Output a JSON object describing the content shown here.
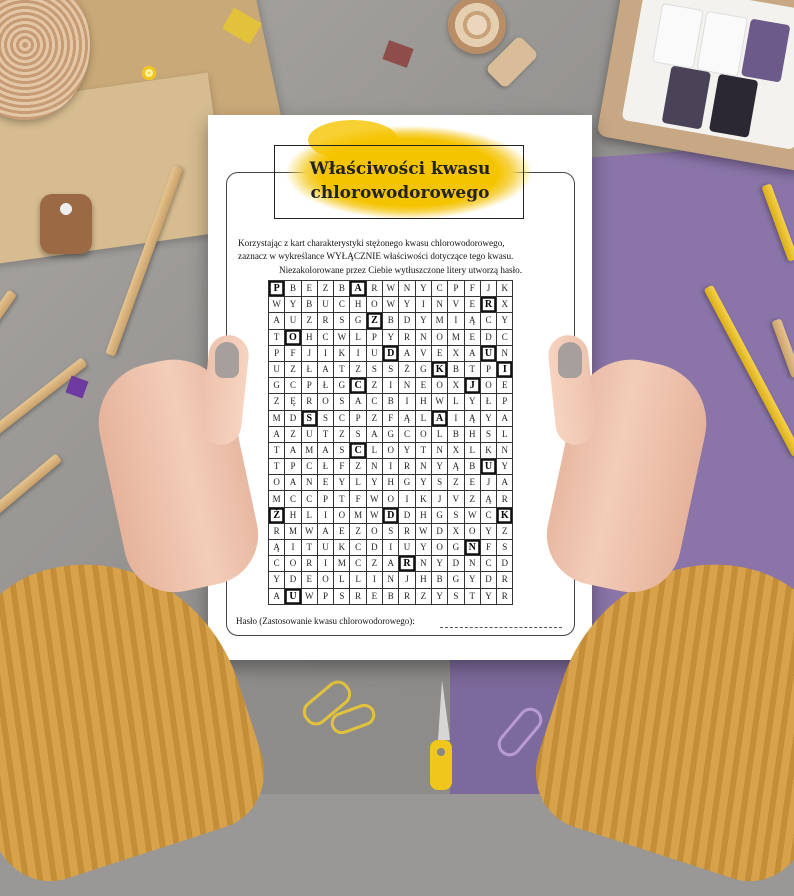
{
  "worksheet": {
    "title_line1": "Właściwości kwasu",
    "title_line2": "chlorowodorowego",
    "intro_line1": "Korzystając z kart charakterystyki stężonego kwasu chlorowodorowego,",
    "intro_line2": "zaznacz w wykreślance WYŁĄCZNIE właściwości dotyczące tego kwasu.",
    "hint": "Niezakolorowane przez Ciebie wytłuszczone litery utworzą hasło.",
    "answer_label": "Hasło (Zastosowanie kwasu chlorowodorowego):"
  },
  "grid": {
    "rows": [
      [
        "P",
        "B",
        "E",
        "Z",
        "B",
        "A",
        "R",
        "W",
        "N",
        "Y",
        "C",
        "P",
        "F",
        "J",
        "K"
      ],
      [
        "W",
        "Y",
        "B",
        "U",
        "C",
        "H",
        "O",
        "W",
        "Y",
        "I",
        "N",
        "V",
        "E",
        "R",
        "X"
      ],
      [
        "A",
        "U",
        "Z",
        "R",
        "S",
        "G",
        "Z",
        "B",
        "D",
        "Y",
        "M",
        "I",
        "Ą",
        "C",
        "Y"
      ],
      [
        "T",
        "O",
        "H",
        "C",
        "W",
        "L",
        "P",
        "Y",
        "R",
        "N",
        "O",
        "M",
        "E",
        "D",
        "C"
      ],
      [
        "P",
        "F",
        "J",
        "I",
        "K",
        "I",
        "U",
        "D",
        "A",
        "V",
        "E",
        "X",
        "A",
        "U",
        "N"
      ],
      [
        "U",
        "Z",
        "Ł",
        "A",
        "T",
        "Z",
        "S",
        "S",
        "Ż",
        "G",
        "K",
        "B",
        "T",
        "P",
        "I"
      ],
      [
        "G",
        "C",
        "P",
        "Ł",
        "G",
        "C",
        "Z",
        "I",
        "N",
        "E",
        "O",
        "X",
        "J",
        "O",
        "E"
      ],
      [
        "Z",
        "Ę",
        "R",
        "O",
        "S",
        "A",
        "C",
        "B",
        "I",
        "H",
        "W",
        "L",
        "Y",
        "Ł",
        "P"
      ],
      [
        "M",
        "D",
        "S",
        "S",
        "C",
        "P",
        "Z",
        "F",
        "Ą",
        "L",
        "A",
        "I",
        "Ą",
        "Y",
        "A"
      ],
      [
        "A",
        "Z",
        "U",
        "T",
        "Z",
        "S",
        "A",
        "G",
        "C",
        "O",
        "L",
        "B",
        "H",
        "S",
        "L"
      ],
      [
        "T",
        "A",
        "M",
        "A",
        "S",
        "C",
        "L",
        "O",
        "Y",
        "T",
        "N",
        "X",
        "L",
        "K",
        "N"
      ],
      [
        "T",
        "P",
        "C",
        "Ł",
        "F",
        "Z",
        "N",
        "I",
        "R",
        "N",
        "Y",
        "Ą",
        "B",
        "U",
        "Y"
      ],
      [
        "O",
        "A",
        "N",
        "E",
        "Y",
        "L",
        "Y",
        "H",
        "G",
        "Y",
        "S",
        "Z",
        "E",
        "J",
        "A"
      ],
      [
        "M",
        "C",
        "C",
        "P",
        "T",
        "F",
        "W",
        "O",
        "I",
        "K",
        "J",
        "V",
        "Z",
        "Ą",
        "R"
      ],
      [
        "Ż",
        "H",
        "L",
        "I",
        "O",
        "M",
        "W",
        "D",
        "D",
        "H",
        "G",
        "S",
        "W",
        "C",
        "K"
      ],
      [
        "R",
        "M",
        "W",
        "A",
        "E",
        "Z",
        "O",
        "S",
        "R",
        "W",
        "D",
        "X",
        "O",
        "Y",
        "Z"
      ],
      [
        "Ą",
        "I",
        "T",
        "U",
        "K",
        "C",
        "D",
        "I",
        "U",
        "Y",
        "O",
        "G",
        "N",
        "F",
        "S"
      ],
      [
        "C",
        "O",
        "R",
        "I",
        "M",
        "C",
        "Z",
        "A",
        "R",
        "N",
        "Y",
        "D",
        "N",
        "C",
        "D"
      ],
      [
        "Y",
        "D",
        "E",
        "O",
        "L",
        "L",
        "I",
        "N",
        "J",
        "H",
        "B",
        "G",
        "Y",
        "D",
        "R"
      ],
      [
        "A",
        "U",
        "W",
        "P",
        "S",
        "R",
        "E",
        "B",
        "R",
        "Z",
        "Y",
        "S",
        "T",
        "Y",
        "R"
      ]
    ]
  }
}
